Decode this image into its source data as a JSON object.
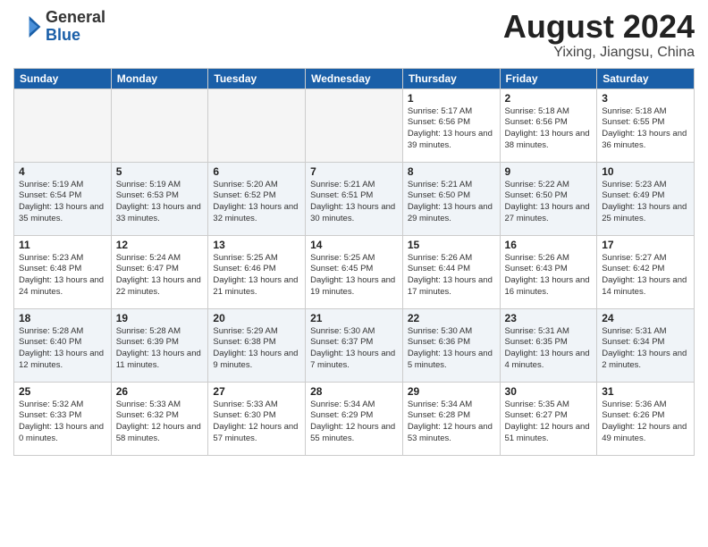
{
  "header": {
    "logo_general": "General",
    "logo_blue": "Blue",
    "month_year": "August 2024",
    "location": "Yixing, Jiangsu, China"
  },
  "days_of_week": [
    "Sunday",
    "Monday",
    "Tuesday",
    "Wednesday",
    "Thursday",
    "Friday",
    "Saturday"
  ],
  "weeks": [
    [
      {
        "day": "",
        "empty": true
      },
      {
        "day": "",
        "empty": true
      },
      {
        "day": "",
        "empty": true
      },
      {
        "day": "",
        "empty": true
      },
      {
        "day": "1",
        "sunrise": "5:17 AM",
        "sunset": "6:56 PM",
        "daylight": "13 hours and 39 minutes."
      },
      {
        "day": "2",
        "sunrise": "5:18 AM",
        "sunset": "6:56 PM",
        "daylight": "13 hours and 38 minutes."
      },
      {
        "day": "3",
        "sunrise": "5:18 AM",
        "sunset": "6:55 PM",
        "daylight": "13 hours and 36 minutes."
      }
    ],
    [
      {
        "day": "4",
        "sunrise": "5:19 AM",
        "sunset": "6:54 PM",
        "daylight": "13 hours and 35 minutes."
      },
      {
        "day": "5",
        "sunrise": "5:19 AM",
        "sunset": "6:53 PM",
        "daylight": "13 hours and 33 minutes."
      },
      {
        "day": "6",
        "sunrise": "5:20 AM",
        "sunset": "6:52 PM",
        "daylight": "13 hours and 32 minutes."
      },
      {
        "day": "7",
        "sunrise": "5:21 AM",
        "sunset": "6:51 PM",
        "daylight": "13 hours and 30 minutes."
      },
      {
        "day": "8",
        "sunrise": "5:21 AM",
        "sunset": "6:50 PM",
        "daylight": "13 hours and 29 minutes."
      },
      {
        "day": "9",
        "sunrise": "5:22 AM",
        "sunset": "6:50 PM",
        "daylight": "13 hours and 27 minutes."
      },
      {
        "day": "10",
        "sunrise": "5:23 AM",
        "sunset": "6:49 PM",
        "daylight": "13 hours and 25 minutes."
      }
    ],
    [
      {
        "day": "11",
        "sunrise": "5:23 AM",
        "sunset": "6:48 PM",
        "daylight": "13 hours and 24 minutes."
      },
      {
        "day": "12",
        "sunrise": "5:24 AM",
        "sunset": "6:47 PM",
        "daylight": "13 hours and 22 minutes."
      },
      {
        "day": "13",
        "sunrise": "5:25 AM",
        "sunset": "6:46 PM",
        "daylight": "13 hours and 21 minutes."
      },
      {
        "day": "14",
        "sunrise": "5:25 AM",
        "sunset": "6:45 PM",
        "daylight": "13 hours and 19 minutes."
      },
      {
        "day": "15",
        "sunrise": "5:26 AM",
        "sunset": "6:44 PM",
        "daylight": "13 hours and 17 minutes."
      },
      {
        "day": "16",
        "sunrise": "5:26 AM",
        "sunset": "6:43 PM",
        "daylight": "13 hours and 16 minutes."
      },
      {
        "day": "17",
        "sunrise": "5:27 AM",
        "sunset": "6:42 PM",
        "daylight": "13 hours and 14 minutes."
      }
    ],
    [
      {
        "day": "18",
        "sunrise": "5:28 AM",
        "sunset": "6:40 PM",
        "daylight": "13 hours and 12 minutes."
      },
      {
        "day": "19",
        "sunrise": "5:28 AM",
        "sunset": "6:39 PM",
        "daylight": "13 hours and 11 minutes."
      },
      {
        "day": "20",
        "sunrise": "5:29 AM",
        "sunset": "6:38 PM",
        "daylight": "13 hours and 9 minutes."
      },
      {
        "day": "21",
        "sunrise": "5:30 AM",
        "sunset": "6:37 PM",
        "daylight": "13 hours and 7 minutes."
      },
      {
        "day": "22",
        "sunrise": "5:30 AM",
        "sunset": "6:36 PM",
        "daylight": "13 hours and 5 minutes."
      },
      {
        "day": "23",
        "sunrise": "5:31 AM",
        "sunset": "6:35 PM",
        "daylight": "13 hours and 4 minutes."
      },
      {
        "day": "24",
        "sunrise": "5:31 AM",
        "sunset": "6:34 PM",
        "daylight": "13 hours and 2 minutes."
      }
    ],
    [
      {
        "day": "25",
        "sunrise": "5:32 AM",
        "sunset": "6:33 PM",
        "daylight": "13 hours and 0 minutes."
      },
      {
        "day": "26",
        "sunrise": "5:33 AM",
        "sunset": "6:32 PM",
        "daylight": "12 hours and 58 minutes."
      },
      {
        "day": "27",
        "sunrise": "5:33 AM",
        "sunset": "6:30 PM",
        "daylight": "12 hours and 57 minutes."
      },
      {
        "day": "28",
        "sunrise": "5:34 AM",
        "sunset": "6:29 PM",
        "daylight": "12 hours and 55 minutes."
      },
      {
        "day": "29",
        "sunrise": "5:34 AM",
        "sunset": "6:28 PM",
        "daylight": "12 hours and 53 minutes."
      },
      {
        "day": "30",
        "sunrise": "5:35 AM",
        "sunset": "6:27 PM",
        "daylight": "12 hours and 51 minutes."
      },
      {
        "day": "31",
        "sunrise": "5:36 AM",
        "sunset": "6:26 PM",
        "daylight": "12 hours and 49 minutes."
      }
    ]
  ]
}
